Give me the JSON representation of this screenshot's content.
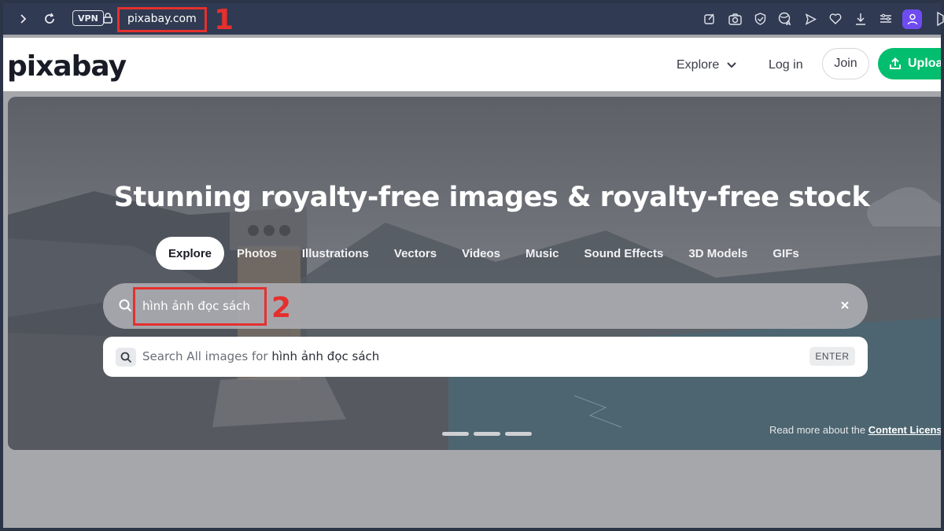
{
  "browser": {
    "vpn_label": "VPN",
    "url": "pixabay.com",
    "annotation_1": "1"
  },
  "header": {
    "logo": "pixabay",
    "explore_label": "Explore",
    "login_label": "Log in",
    "join_label": "Join",
    "upload_label": "Upload"
  },
  "hero": {
    "title": "Stunning royalty-free images & royalty-free stock",
    "tabs": [
      {
        "label": "Explore",
        "active": true
      },
      {
        "label": "Photos"
      },
      {
        "label": "Illustrations"
      },
      {
        "label": "Vectors"
      },
      {
        "label": "Videos"
      },
      {
        "label": "Music"
      },
      {
        "label": "Sound Effects"
      },
      {
        "label": "3D Models"
      },
      {
        "label": "GIFs"
      }
    ],
    "search_value": "hình ảnh đọc sách",
    "annotation_2": "2",
    "suggestion_prefix": "Search All images for ",
    "suggestion_query": "hình ảnh đọc sách",
    "enter_label": "ENTER",
    "license_text": "Read more about the ",
    "license_link": "Content License"
  },
  "colors": {
    "accent_green": "#02be6e",
    "annotation_red": "#e5302e",
    "profile_purple": "#6e4cf2"
  }
}
